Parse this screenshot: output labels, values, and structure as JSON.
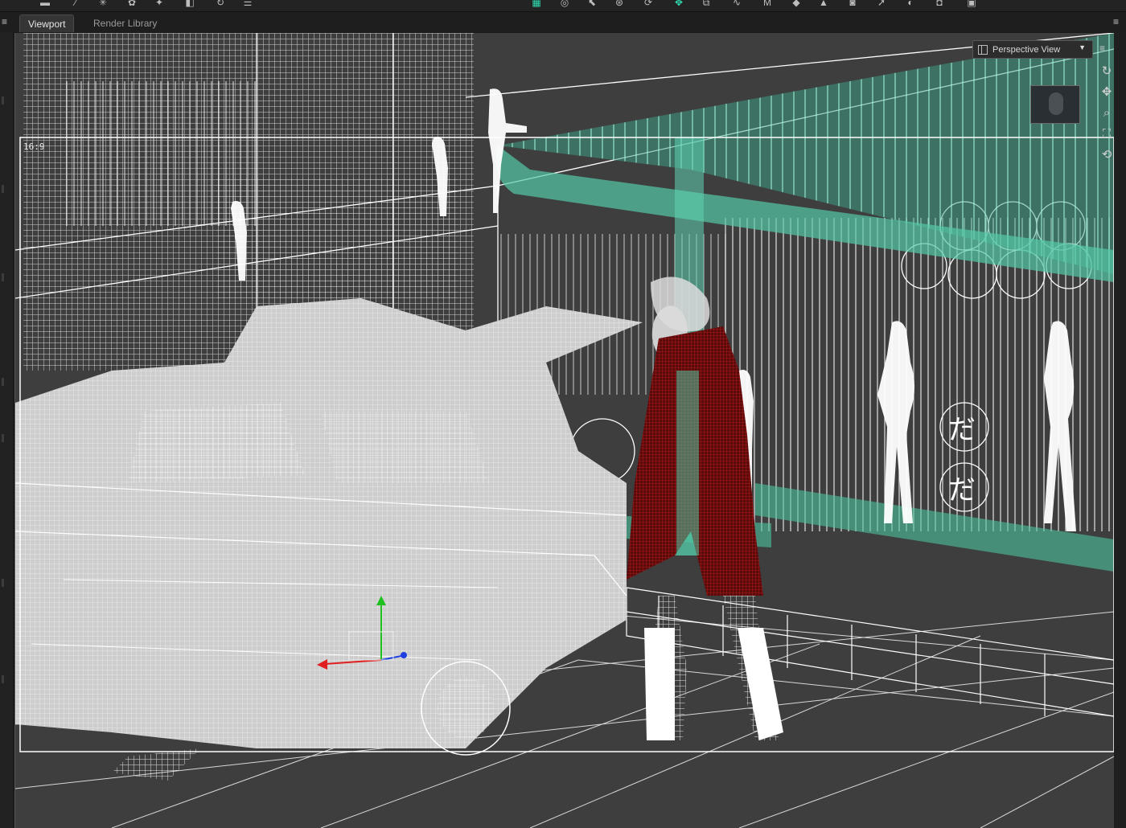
{
  "toolbar": {
    "left_icons": [
      "camera-icon",
      "wand-icon",
      "burst-icon",
      "flower-icon",
      "spark-icon",
      "nodes-icon",
      "rotate-icon",
      "panel-icon"
    ],
    "center_icons": [
      "grid-icon",
      "target-icon",
      "select-icon",
      "universal-icon",
      "orbit-icon",
      "move-icon",
      "scale-icon",
      "joint-icon",
      "morph-icon",
      "paint-icon",
      "fill-icon",
      "camera2-icon",
      "pointer-icon",
      "sphere-icon",
      "render-icon",
      "window-icon"
    ],
    "active_tool": "move-icon"
  },
  "tabs": [
    {
      "label": "Viewport",
      "active": true
    },
    {
      "label": "Render Library",
      "active": false
    }
  ],
  "viewport": {
    "aspect_label": "16:9",
    "view_mode": "Perspective View"
  },
  "colors": {
    "accent": "#2fe0b4",
    "wire_white": "#ffffff",
    "coat_red": "#8b1010",
    "glass_teal": "#4fd8b4",
    "car_gray": "#cfcfcf",
    "background": "#3e3e3e",
    "axis_x": "#e02020",
    "axis_y": "#20c020",
    "axis_z": "#2040e0"
  }
}
